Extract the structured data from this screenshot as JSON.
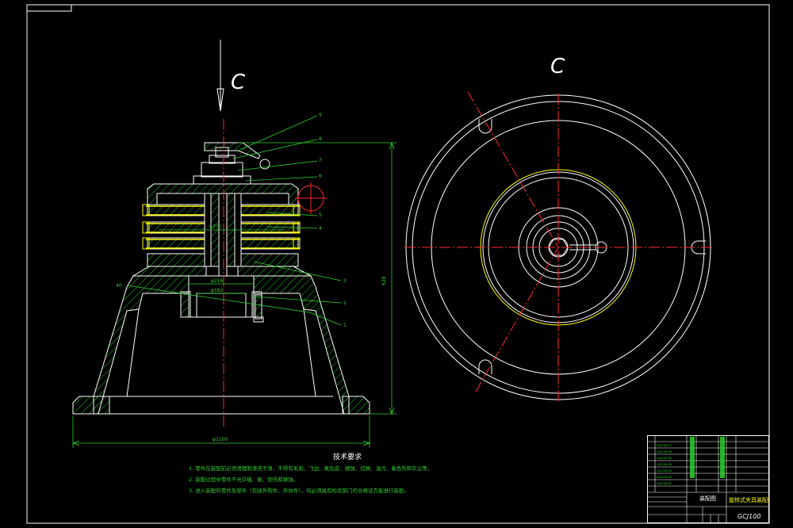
{
  "view_labels": {
    "left_view": "C",
    "right_view": "C"
  },
  "callouts": [
    "9",
    "8",
    "7",
    "6",
    "5",
    "4",
    "3",
    "2",
    "1"
  ],
  "dimensions": {
    "overall_height": "628",
    "base_diameter": "φ1100",
    "upper_bore": "φ216",
    "lower_bore": "φ182",
    "plate_width": "φ770",
    "small_left": "40"
  },
  "technical_requirements": {
    "title": "技术要求",
    "items": [
      "1. 零件在装配前必须清理和清洗干净，不得有毛刺、飞边、氧化皮、锈蚀、切屑、油污、着色剂和灰尘等。",
      "2. 装配过程中零件不允许磕、碰、划伤和锈蚀。",
      "3. 进入装配的零件及部件（包括外购件、外协件），均必须具有检验部门的合格证方能进行装配。"
    ]
  },
  "title_block": {
    "drawing_title": "旋转式夹具装配图",
    "drawing_number": "GCJ100",
    "material_label": "装配图",
    "bom_codes": [
      "GCJ100-07",
      "GCJ100-06",
      "GCJ100-05",
      "GCJ100-04",
      "GCJ100-03",
      "GCJ100-02",
      "GCJ100-01"
    ]
  },
  "colors": {
    "background": "#000000",
    "outline": "#ffffff",
    "section_hatch": "#22c322",
    "center_line": "#ff2a2a",
    "plates": "#ffff00",
    "dimension": "#2fd02f"
  }
}
